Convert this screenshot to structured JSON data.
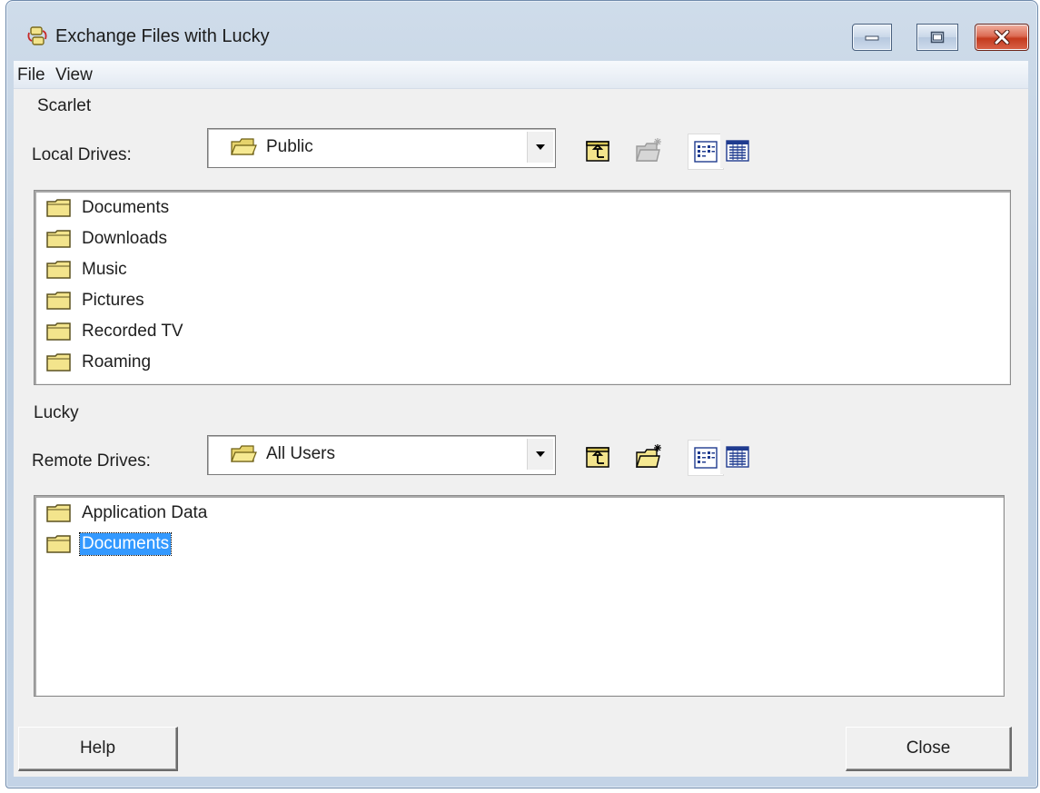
{
  "window": {
    "title": "Exchange Files with Lucky",
    "controls": [
      "minimize",
      "maximize",
      "close"
    ]
  },
  "menu": {
    "file": "File",
    "view": "View"
  },
  "local": {
    "host_name": "Scarlet",
    "drives_label": "Local Drives:",
    "selected_drive": "Public",
    "items": [
      "Documents",
      "Downloads",
      "Music",
      "Pictures",
      "Recorded TV",
      "Roaming"
    ]
  },
  "remote": {
    "host_name": "Lucky",
    "drives_label": "Remote Drives:",
    "selected_drive": "All Users",
    "items": [
      "Application Data",
      "Documents"
    ],
    "selected_item": "Documents"
  },
  "buttons": {
    "help": "Help",
    "close": "Close"
  },
  "colors": {
    "folder": "#f3e48c",
    "selection": "#3399ff",
    "close_button": "#c43a1e"
  }
}
